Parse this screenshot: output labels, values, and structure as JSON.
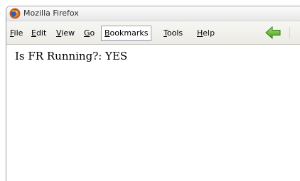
{
  "window": {
    "title": "Mozilla Firefox",
    "icon": "firefox-logo-icon"
  },
  "menu": {
    "file": {
      "mnemonic": "F",
      "rest": "ile"
    },
    "edit": {
      "mnemonic": "E",
      "rest": "dit"
    },
    "view": {
      "mnemonic": "V",
      "rest": "iew"
    },
    "go": {
      "mnemonic": "G",
      "rest": "o"
    },
    "bookmarks": {
      "mnemonic": "B",
      "rest": "ookmarks"
    },
    "tools": {
      "mnemonic": "T",
      "rest": "ools"
    },
    "help": {
      "mnemonic": "H",
      "rest": "elp"
    }
  },
  "toolbar": {
    "back_icon": "back-arrow-icon",
    "back_color": "#4caf2a"
  },
  "page": {
    "status_text": "Is FR Running?: YES"
  }
}
